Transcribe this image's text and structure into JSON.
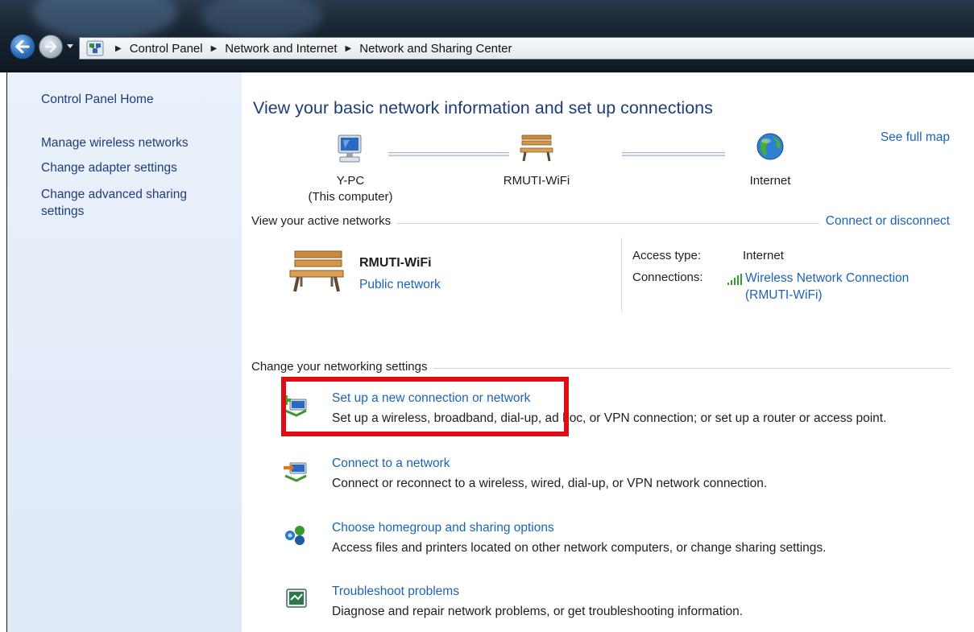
{
  "breadcrumb": {
    "items": [
      "Control Panel",
      "Network and Internet",
      "Network and Sharing Center"
    ]
  },
  "sidebar": {
    "home": "Control Panel Home",
    "items": [
      {
        "label": "Manage wireless networks"
      },
      {
        "label": "Change adapter settings"
      },
      {
        "label": "Change advanced sharing settings"
      }
    ]
  },
  "main": {
    "heading": "View your basic network information and set up connections",
    "see_full_map": "See full map",
    "map": {
      "computer_name": "Y-PC",
      "computer_sub": "(This computer)",
      "network_name": "RMUTI-WiFi",
      "internet": "Internet"
    },
    "active": {
      "section": "View your active networks",
      "connect_link": "Connect or disconnect",
      "network_name": "RMUTI-WiFi",
      "network_type": "Public network",
      "access_label": "Access type:",
      "access_value": "Internet",
      "connections_label": "Connections:",
      "connection_line1": "Wireless Network Connection",
      "connection_line2": "(RMUTI-WiFi)"
    },
    "change": {
      "section": "Change your networking settings",
      "tasks": [
        {
          "title": "Set up a new connection or network",
          "desc": "Set up a wireless, broadband, dial-up, ad hoc, or VPN connection; or set up a router or access point."
        },
        {
          "title": "Connect to a network",
          "desc": "Connect or reconnect to a wireless, wired, dial-up, or VPN network connection."
        },
        {
          "title": "Choose homegroup and sharing options",
          "desc": "Access files and printers located on other network computers, or change sharing settings."
        },
        {
          "title": "Troubleshoot problems",
          "desc": "Diagnose and repair network problems, or get troubleshooting information."
        }
      ]
    }
  },
  "colors": {
    "link": "#1c63b6",
    "heading": "#1e3d78",
    "highlight": "#e10b14"
  }
}
